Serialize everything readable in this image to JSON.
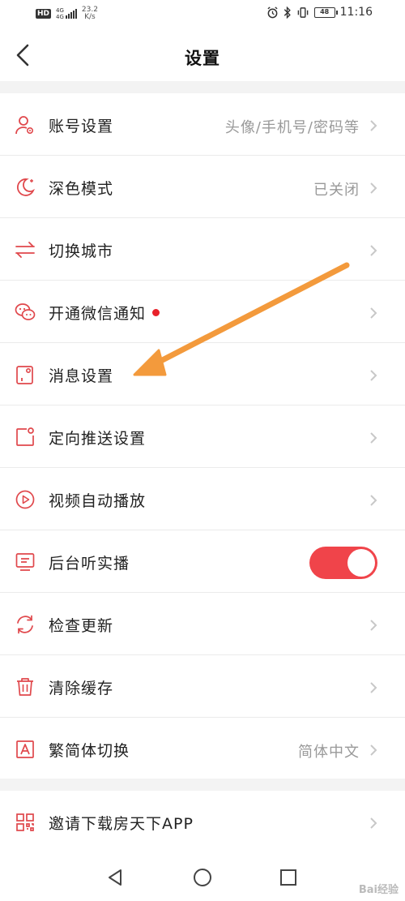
{
  "status_bar": {
    "hd": "HD",
    "signal1": "4G",
    "signal2": "4G",
    "speed_value": "23.2",
    "speed_unit": "K/s",
    "battery": "48",
    "time": "11:16"
  },
  "header": {
    "title": "设置",
    "back_icon": "chevron-left-icon"
  },
  "settings_group_1": [
    {
      "label": "账号设置",
      "value": "头像/手机号/密码等",
      "icon": "user-gear-icon"
    },
    {
      "label": "深色模式",
      "value": "已关闭",
      "icon": "moon-icon"
    },
    {
      "label": "切换城市",
      "value": "",
      "icon": "swap-icon"
    },
    {
      "label": "开通微信通知",
      "value": "",
      "icon": "wechat-icon",
      "badge": true
    },
    {
      "label": "消息设置",
      "value": "",
      "icon": "message-settings-icon"
    },
    {
      "label": "定向推送设置",
      "value": "",
      "icon": "push-icon"
    },
    {
      "label": "视频自动播放",
      "value": "",
      "icon": "play-icon"
    },
    {
      "label": "后台听实播",
      "value": "",
      "icon": "tv-icon",
      "toggle_on": true
    },
    {
      "label": "检查更新",
      "value": "",
      "icon": "refresh-icon"
    },
    {
      "label": "清除缓存",
      "value": "",
      "icon": "trash-icon"
    },
    {
      "label": "繁简体切换",
      "value": "简体中文",
      "icon": "font-a-icon"
    }
  ],
  "settings_group_2": [
    {
      "label": "邀请下载房天下APP",
      "value": "",
      "icon": "qr-code-icon"
    }
  ],
  "colors": {
    "accent": "#e0484c",
    "toggle": "#f0444a",
    "badge": "#e8222a",
    "annotation_arrow": "#f39a3c"
  },
  "navbar": {
    "back_icon": "triangle-back-icon",
    "home_icon": "circle-home-icon",
    "recents_icon": "square-recents-icon"
  },
  "watermark": "Bai经验"
}
